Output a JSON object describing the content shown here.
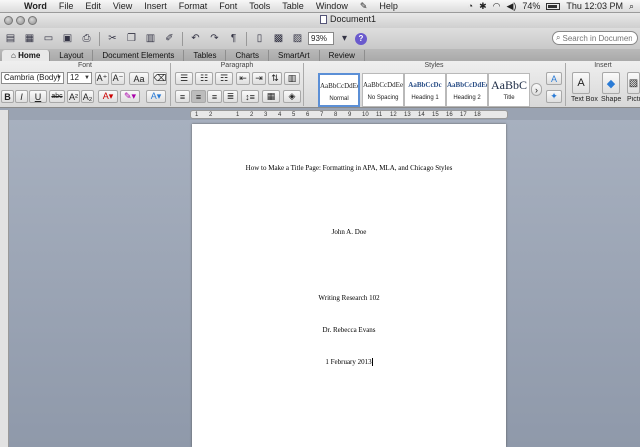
{
  "menubar": {
    "app": "Word",
    "items": [
      "File",
      "Edit",
      "View",
      "Insert",
      "Format",
      "Font",
      "Tools",
      "Table",
      "Window",
      "Help"
    ],
    "battery": "74%",
    "clock": "Thu 12:03 PM"
  },
  "window": {
    "title": "Document1"
  },
  "toolbar": {
    "zoom": "93%",
    "search_placeholder": "Search in Document"
  },
  "ribbon": {
    "tabs": [
      "Home",
      "Layout",
      "Document Elements",
      "Tables",
      "Charts",
      "SmartArt",
      "Review"
    ],
    "active_tab": "Home",
    "groups": {
      "font": "Font",
      "paragraph": "Paragraph",
      "styles": "Styles",
      "insert": "Insert"
    },
    "font_name": "Cambria (Body)",
    "font_size": "12",
    "styles": [
      {
        "sample": "AaBbCcDdEe",
        "name": "Normal"
      },
      {
        "sample": "AaBbCcDdEe",
        "name": "No Spacing"
      },
      {
        "sample": "AaBbCcDc",
        "name": "Heading 1"
      },
      {
        "sample": "AaBbCcDdEe",
        "name": "Heading 2"
      },
      {
        "sample": "AaBbC",
        "name": "Title"
      }
    ],
    "insert_items": [
      "Text Box",
      "Shape",
      "Pictu"
    ]
  },
  "ruler": {
    "ticks": [
      "1",
      "2",
      "1",
      "2",
      "3",
      "4",
      "5",
      "6",
      "7",
      "8",
      "9",
      "10",
      "11",
      "12",
      "13",
      "14",
      "15",
      "16",
      "17",
      "18"
    ]
  },
  "document": {
    "lines": [
      "How to Make a Title Page: Formatting in APA, MLA, and Chicago Styles",
      "John A. Doe",
      "Writing Research 102",
      "Dr. Rebecca Evans",
      "1 February 2013"
    ]
  },
  "colors": {
    "accent": "#5b8fd6",
    "canvas": "#9aa3b2",
    "heading": "#2a4e86"
  }
}
